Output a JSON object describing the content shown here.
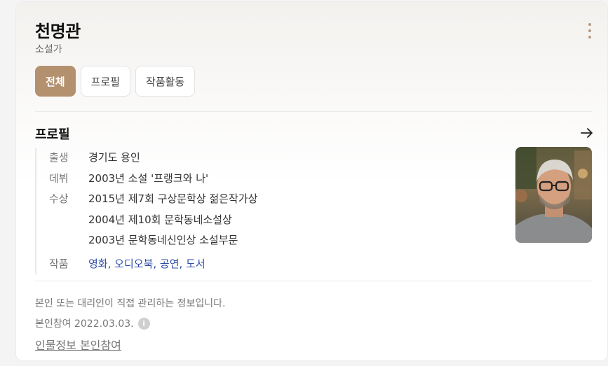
{
  "profile": {
    "name": "천명관",
    "role": "소설가"
  },
  "tabs": [
    {
      "label": "전체",
      "active": true
    },
    {
      "label": "프로필",
      "active": false
    },
    {
      "label": "작품활동",
      "active": false
    }
  ],
  "section": {
    "title": "프로필"
  },
  "info": {
    "birth_label": "출생",
    "birth_value": "경기도 용인",
    "debut_label": "데뷔",
    "debut_value": "2003년 소설 '프랭크와 나'",
    "awards_label": "수상",
    "awards": [
      "2015년 제7회 구상문학상 젊은작가상",
      "2004년 제10회 문학동네소설상",
      "2003년 문학동네신인상 소설부문"
    ],
    "works_label": "작품",
    "works": [
      "영화",
      "오디오북",
      "공연",
      "도서"
    ]
  },
  "footer": {
    "note": "본인 또는 대리인이 직접 관리하는 정보입니다.",
    "joined": "본인참여 2022.03.03.",
    "participate_link": "인물정보 본인참여"
  },
  "colors": {
    "accent": "#b3906e",
    "link": "#2f4ea8"
  },
  "icons": {
    "more": "more-vertical-icon",
    "arrow": "arrow-right-icon",
    "info": "info-icon"
  }
}
